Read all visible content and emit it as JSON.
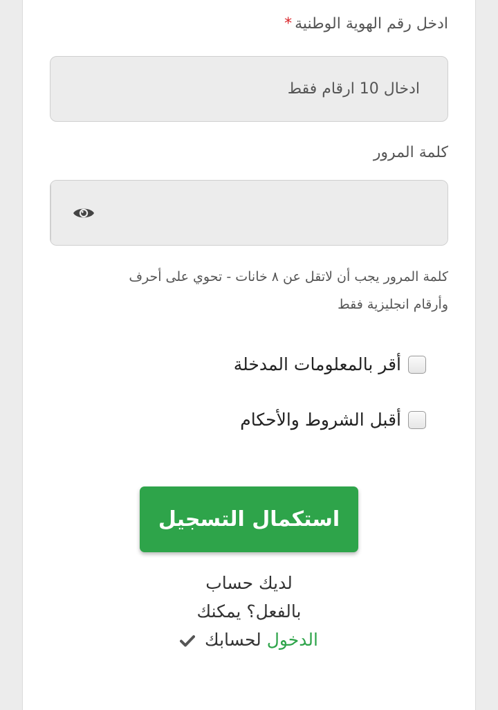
{
  "form": {
    "national_id": {
      "label": "ادخل رقم الهوية الوطنية",
      "required_mark": "*",
      "placeholder": "ادخال 10 ارقام فقط",
      "value": ""
    },
    "password": {
      "label": "كلمة المرور",
      "value": "",
      "toggle_icon": "eye-icon",
      "hint_line1": "كلمة المرور يجب أن لاتقل عن ٨ خانات - تحوي على أحرف",
      "hint_line2": "وأرقام انجليزية فقط"
    },
    "checkboxes": [
      {
        "label": "أقر بالمعلومات المدخلة",
        "checked": false
      },
      {
        "label": "أقبل الشروط والأحكام",
        "checked": false
      }
    ],
    "submit_label": "استكمال التسجيل"
  },
  "login_prompt": {
    "line1": "لديك حساب",
    "line2": "بالفعل؟ يمكنك",
    "link_text": "الدخول",
    "after_link": " لحسابك",
    "icon": "checkmark-icon"
  },
  "colors": {
    "accent_green": "#2ea44a",
    "required_red": "#d9262b",
    "field_bg": "#ececec"
  }
}
